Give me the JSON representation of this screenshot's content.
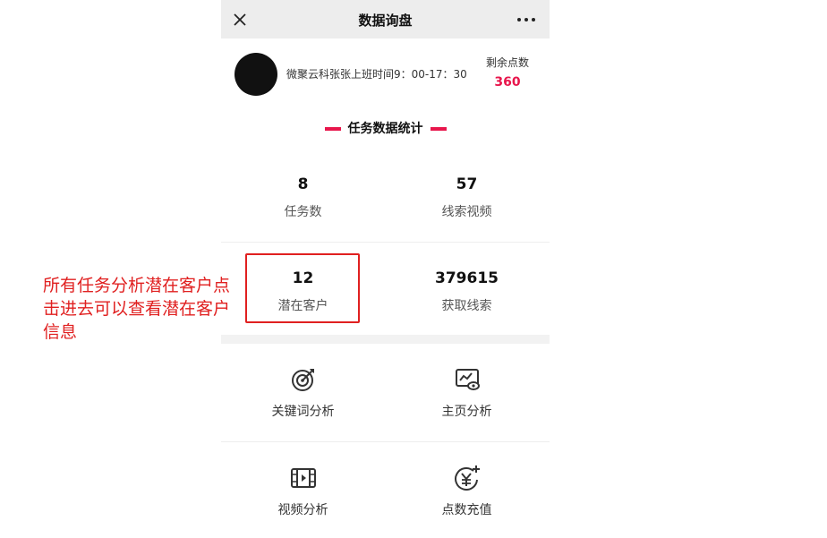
{
  "header": {
    "title": "数据询盘"
  },
  "profile": {
    "name": "微聚云科张张上班时间9：00-17：30",
    "points_label": "剩余点数",
    "points_value": "360"
  },
  "section": {
    "title": "任务数据统计"
  },
  "stats": [
    {
      "value": "8",
      "label": "任务数"
    },
    {
      "value": "57",
      "label": "线索视频"
    },
    {
      "value": "12",
      "label": "潜在客户"
    },
    {
      "value": "379615",
      "label": "获取线索"
    }
  ],
  "tools": [
    {
      "label": "关键词分析",
      "icon": "target-icon"
    },
    {
      "label": "主页分析",
      "icon": "chart-eye-icon"
    },
    {
      "label": "视频分析",
      "icon": "film-icon"
    },
    {
      "label": "点数充值",
      "icon": "yuan-plus-icon"
    }
  ],
  "annotation": {
    "text": "所有任务分析潜在客户点击进去可以查看潜在客户信息"
  },
  "colors": {
    "accent": "#e8164c",
    "annotation_red": "#e02020",
    "header_bg": "#ededed"
  }
}
